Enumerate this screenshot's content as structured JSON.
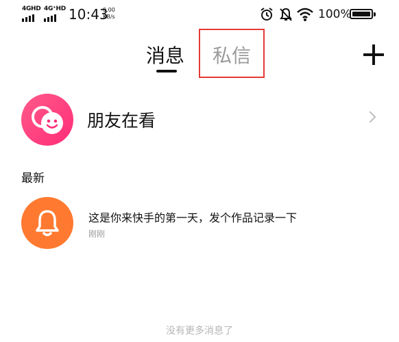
{
  "status_bar": {
    "signal_1_label": "4GHD",
    "signal_2_label": "4G⁺HD",
    "time": "10:43",
    "speed_value": "0.00",
    "speed_unit": "KB/s",
    "icons": [
      "alarm-icon",
      "mute-bell-icon",
      "wifi-icon"
    ],
    "battery_percent": "100%"
  },
  "header": {
    "tabs": [
      {
        "label": "消息",
        "active": true
      },
      {
        "label": "私信",
        "active": false
      }
    ],
    "add_icon": "plus-icon",
    "highlight_color": "#e53935"
  },
  "friends_watching": {
    "label": "朋友在看",
    "icon": "smiley-chat-icon",
    "accent": "#ff2d78"
  },
  "latest": {
    "section_title": "最新",
    "items": [
      {
        "icon": "bell-icon",
        "text": "这是你来快手的第一天，发个作品记录一下",
        "time": "刚刚",
        "accent": "#ff7a30"
      }
    ]
  },
  "footer_text": "没有更多消息了"
}
